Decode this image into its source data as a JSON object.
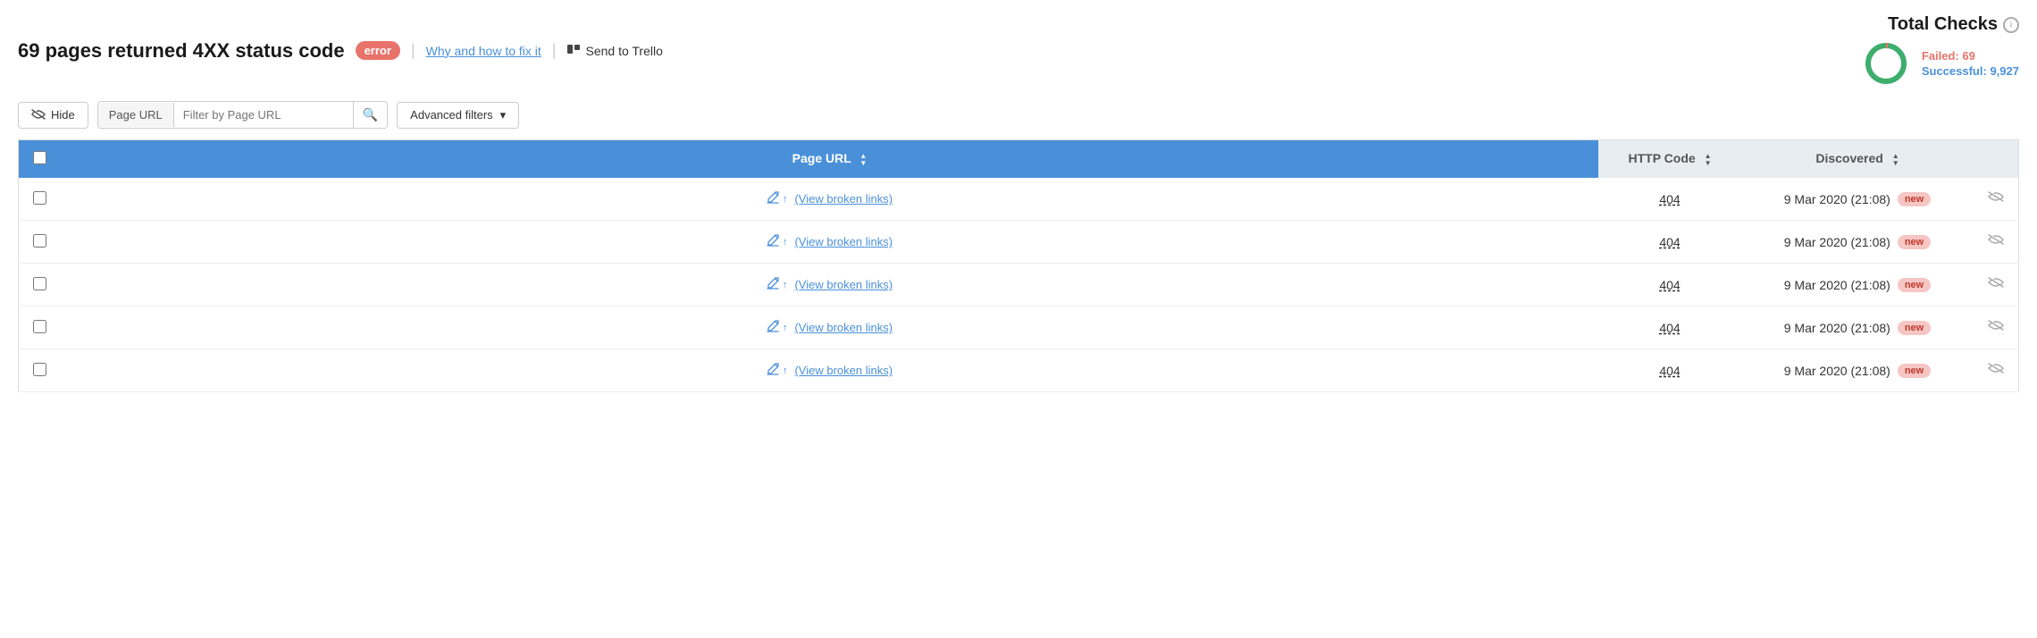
{
  "header": {
    "title": "69 pages returned 4XX status code",
    "badge": "error",
    "fix_link": "Why and how to fix it",
    "trello_label": "Send to Trello"
  },
  "total_checks": {
    "title": "Total Checks",
    "failed_label": "Failed:",
    "failed_value": "69",
    "successful_label": "Successful:",
    "successful_value": "9,927",
    "donut": {
      "failed_color": "#3dae6e",
      "bg_color": "#e8736a",
      "total": 9996,
      "failed": 69
    }
  },
  "toolbar": {
    "hide_label": "Hide",
    "filter_label": "Page URL",
    "filter_placeholder": "Filter by Page URL",
    "advanced_filters_label": "Advanced filters"
  },
  "table": {
    "columns": {
      "page_url": "Page URL",
      "http_code": "HTTP Code",
      "discovered": "Discovered"
    },
    "rows": [
      {
        "url_link": "(View broken links)",
        "http_code": "404",
        "discovered": "9 Mar 2020 (21:08)",
        "badge": "new"
      },
      {
        "url_link": "(View broken links)",
        "http_code": "404",
        "discovered": "9 Mar 2020 (21:08)",
        "badge": "new"
      },
      {
        "url_link": "(View broken links)",
        "http_code": "404",
        "discovered": "9 Mar 2020 (21:08)",
        "badge": "new"
      },
      {
        "url_link": "(View broken links)",
        "http_code": "404",
        "discovered": "9 Mar 2020 (21:08)",
        "badge": "new"
      },
      {
        "url_link": "(View broken links)",
        "http_code": "404",
        "discovered": "9 Mar 2020 (21:08)",
        "badge": "new"
      }
    ]
  }
}
